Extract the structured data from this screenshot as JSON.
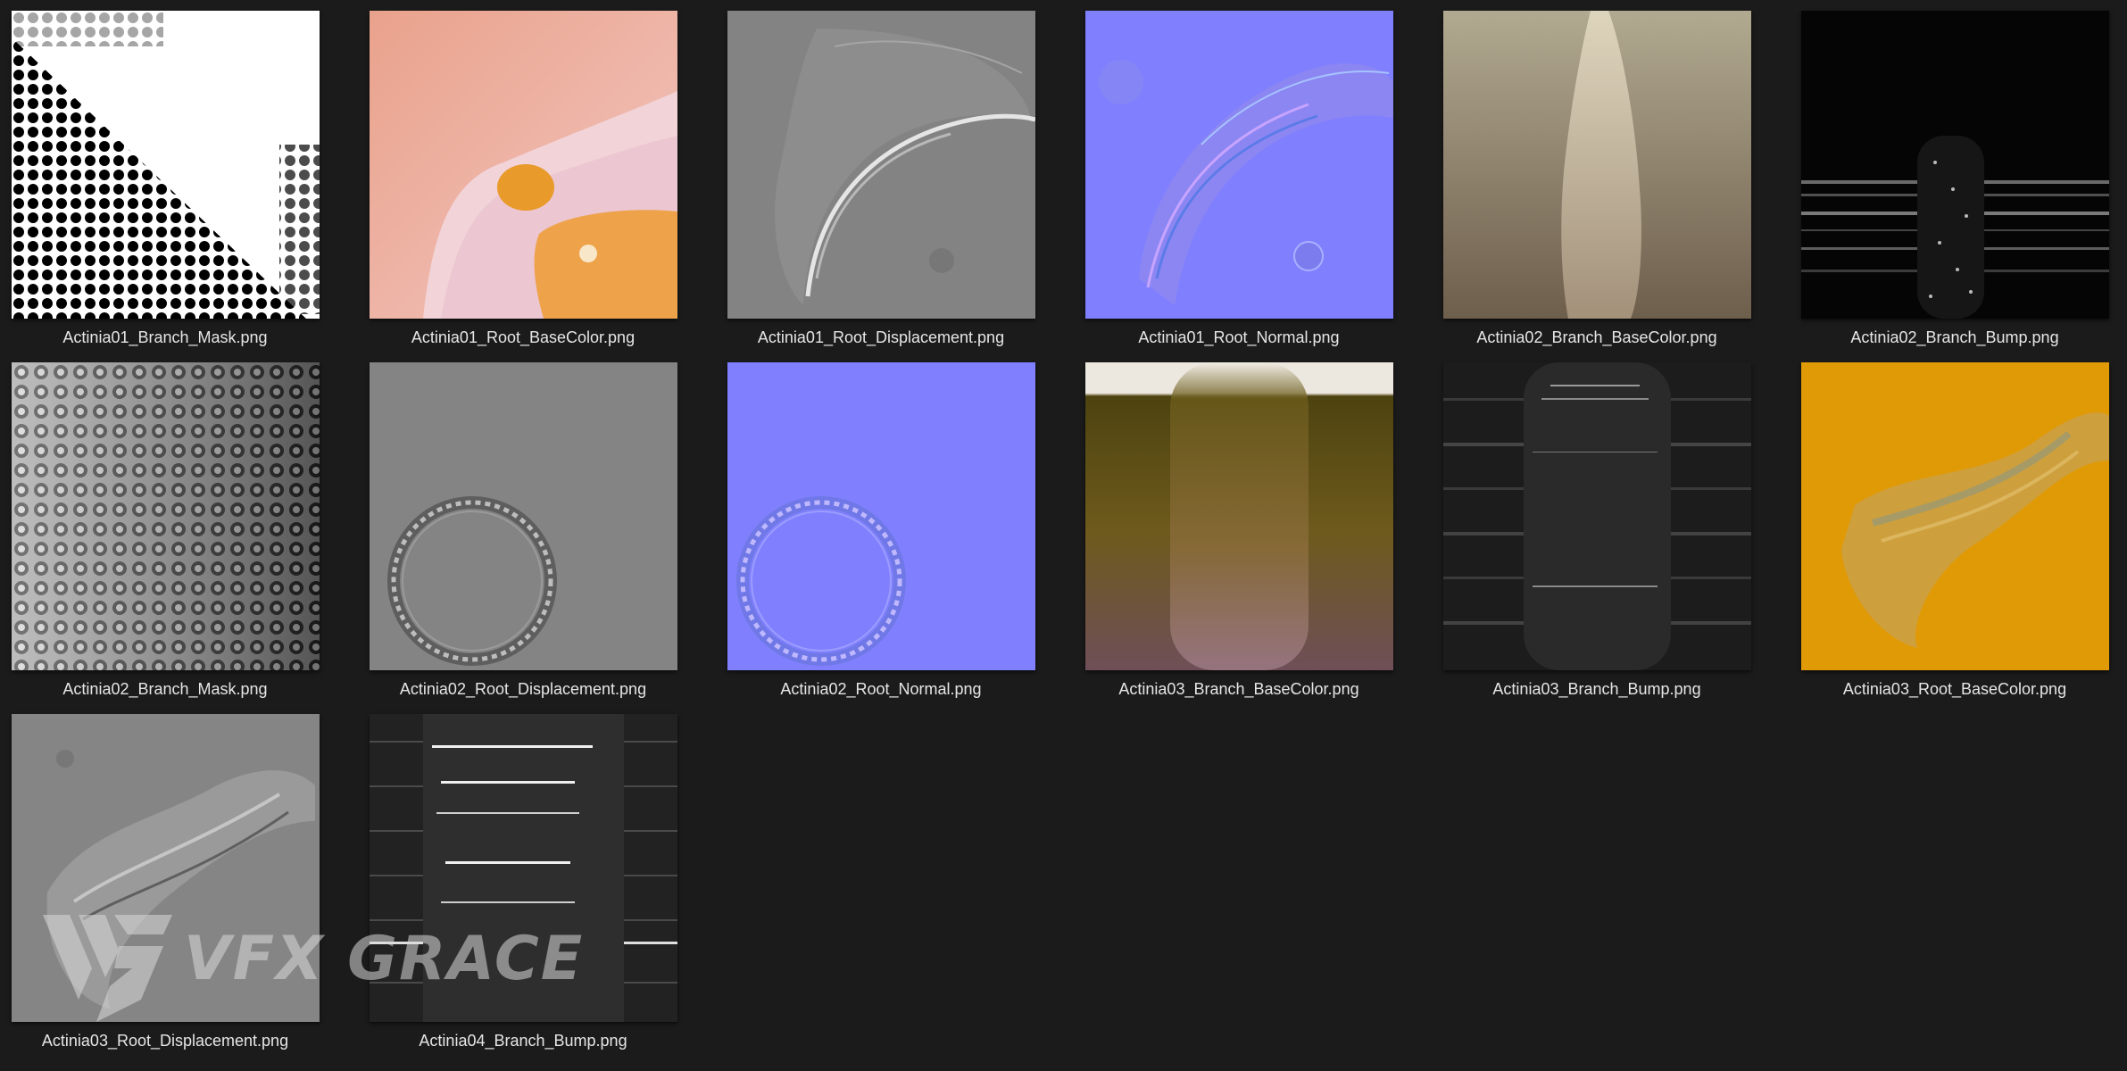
{
  "files": [
    {
      "name": "Actinia01_Branch_Mask.png",
      "preview": "halftone mask"
    },
    {
      "name": "Actinia01_Root_BaseColor.png",
      "preview": "pink with orange patches"
    },
    {
      "name": "Actinia01_Root_Displacement.png",
      "preview": "grey displacement arc"
    },
    {
      "name": "Actinia01_Root_Normal.png",
      "preview": "blue normal map arc"
    },
    {
      "name": "Actinia02_Branch_BaseColor.png",
      "preview": "beige branch"
    },
    {
      "name": "Actinia02_Branch_Bump.png",
      "preview": "black with streaks"
    },
    {
      "name": "Actinia02_Branch_Mask.png",
      "preview": "grey halftone mask"
    },
    {
      "name": "Actinia02_Root_Displacement.png",
      "preview": "grey ring"
    },
    {
      "name": "Actinia02_Root_Normal.png",
      "preview": "blue ring"
    },
    {
      "name": "Actinia03_Branch_BaseColor.png",
      "preview": "olive to mauve gradient"
    },
    {
      "name": "Actinia03_Branch_Bump.png",
      "preview": "dark streaks"
    },
    {
      "name": "Actinia03_Root_BaseColor.png",
      "preview": "orange with arc"
    },
    {
      "name": "Actinia03_Root_Displacement.png",
      "preview": "grey arc"
    },
    {
      "name": "Actinia04_Branch_Bump.png",
      "preview": "dark with white streaks"
    }
  ],
  "watermark": {
    "text": "VFX GRACE"
  },
  "colors": {
    "background": "#1b1b1b",
    "caption": "#e6e6e6",
    "normal_blue": "#8080ff",
    "displacement_grey": "#808080",
    "root_orange": "#e09a06"
  }
}
